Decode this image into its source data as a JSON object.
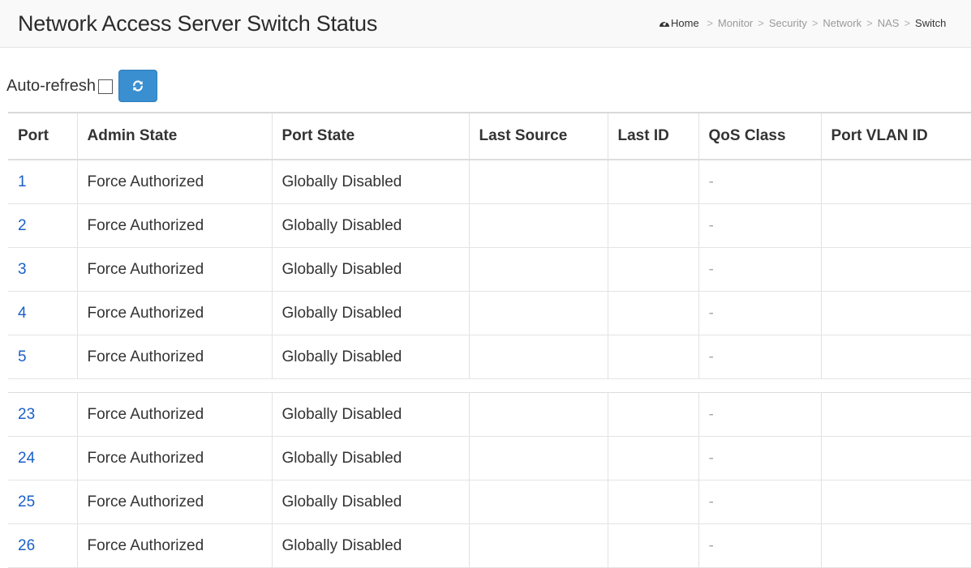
{
  "header": {
    "title": "Network Access Server Switch Status",
    "breadcrumb": {
      "home": "Home",
      "items": [
        "Monitor",
        "Security",
        "Network",
        "NAS"
      ],
      "current": "Switch"
    }
  },
  "toolbar": {
    "auto_refresh_label": "Auto-refresh",
    "auto_refresh_checked": false,
    "refresh_icon": "refresh-icon"
  },
  "table": {
    "columns": [
      "Port",
      "Admin State",
      "Port State",
      "Last Source",
      "Last ID",
      "QoS Class",
      "Port VLAN ID"
    ],
    "rows_top": [
      {
        "port": "1",
        "admin_state": "Force Authorized",
        "port_state": "Globally Disabled",
        "last_source": "",
        "last_id": "",
        "qos_class": "-",
        "port_vlan_id": ""
      },
      {
        "port": "2",
        "admin_state": "Force Authorized",
        "port_state": "Globally Disabled",
        "last_source": "",
        "last_id": "",
        "qos_class": "-",
        "port_vlan_id": ""
      },
      {
        "port": "3",
        "admin_state": "Force Authorized",
        "port_state": "Globally Disabled",
        "last_source": "",
        "last_id": "",
        "qos_class": "-",
        "port_vlan_id": ""
      },
      {
        "port": "4",
        "admin_state": "Force Authorized",
        "port_state": "Globally Disabled",
        "last_source": "",
        "last_id": "",
        "qos_class": "-",
        "port_vlan_id": ""
      },
      {
        "port": "5",
        "admin_state": "Force Authorized",
        "port_state": "Globally Disabled",
        "last_source": "",
        "last_id": "",
        "qos_class": "-",
        "port_vlan_id": ""
      }
    ],
    "rows_bottom": [
      {
        "port": "23",
        "admin_state": "Force Authorized",
        "port_state": "Globally Disabled",
        "last_source": "",
        "last_id": "",
        "qos_class": "-",
        "port_vlan_id": ""
      },
      {
        "port": "24",
        "admin_state": "Force Authorized",
        "port_state": "Globally Disabled",
        "last_source": "",
        "last_id": "",
        "qos_class": "-",
        "port_vlan_id": ""
      },
      {
        "port": "25",
        "admin_state": "Force Authorized",
        "port_state": "Globally Disabled",
        "last_source": "",
        "last_id": "",
        "qos_class": "-",
        "port_vlan_id": ""
      },
      {
        "port": "26",
        "admin_state": "Force Authorized",
        "port_state": "Globally Disabled",
        "last_source": "",
        "last_id": "",
        "qos_class": "-",
        "port_vlan_id": ""
      }
    ]
  },
  "colors": {
    "link": "#1a5fc9",
    "refresh_button": "#3a8fd0",
    "header_bg": "#f9f9f9"
  }
}
